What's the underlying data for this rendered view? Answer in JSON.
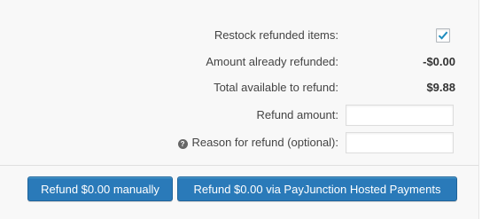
{
  "refund": {
    "restock_label": "Restock refunded items:",
    "restock_checked": true,
    "already_refunded_label": "Amount already refunded:",
    "already_refunded_value": "-$0.00",
    "available_label": "Total available to refund:",
    "available_value": "$9.88",
    "amount_label": "Refund amount:",
    "amount_value": "",
    "reason_label": "Reason for refund (optional):",
    "reason_value": "",
    "help_icon_glyph": "?"
  },
  "actions": {
    "manual_button": "Refund $0.00 manually",
    "gateway_button": "Refund $0.00 via PayJunction Hosted Payments"
  },
  "colors": {
    "button_primary": "#2a7ab9",
    "checkmark": "#1e8cbe",
    "panel_background": "#f8f8f8"
  }
}
